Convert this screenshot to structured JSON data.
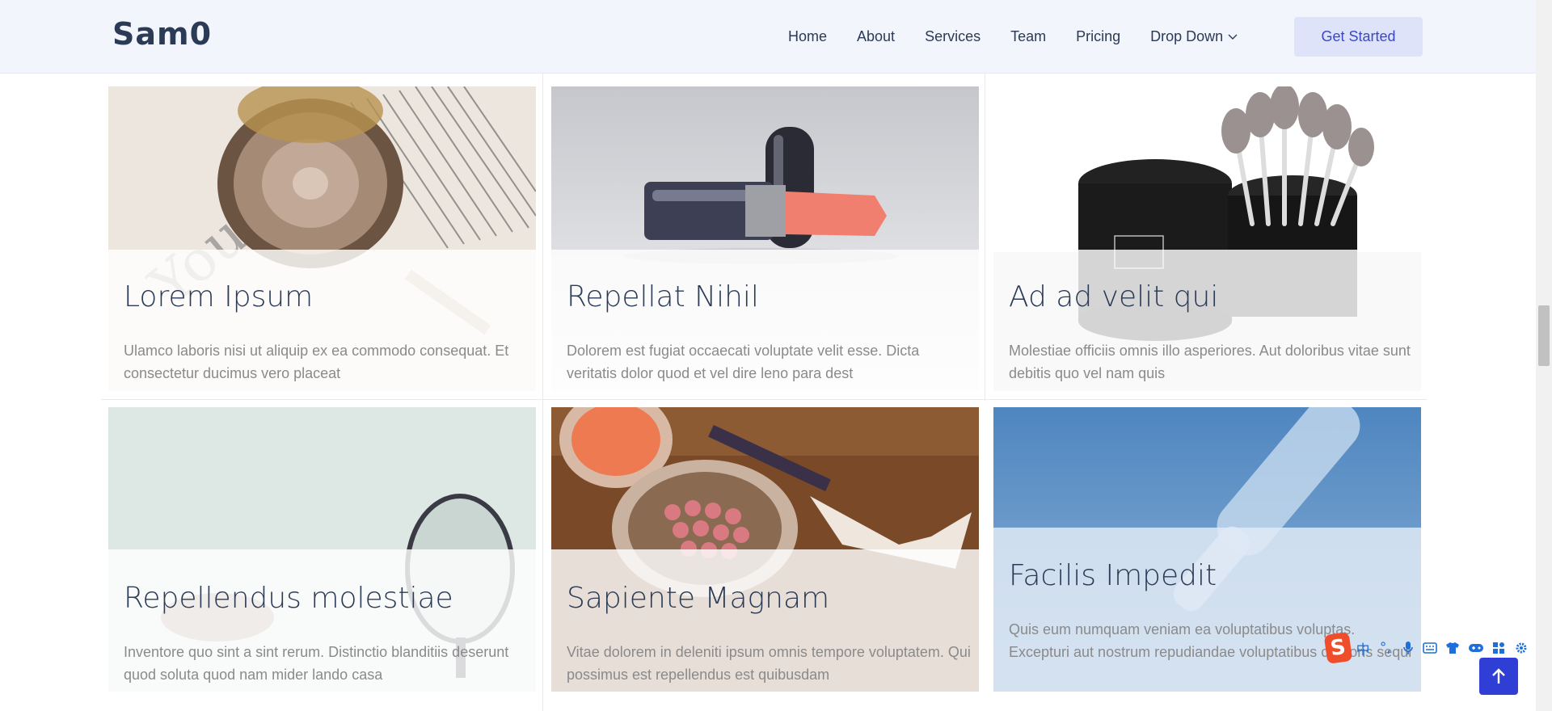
{
  "brand": {
    "logo": "Sam0"
  },
  "nav": {
    "items": [
      "Home",
      "About",
      "Services",
      "Team",
      "Pricing",
      "Drop Down"
    ],
    "cta": "Get Started"
  },
  "cards": [
    {
      "title": "Lorem Ipsum",
      "desc": "Ulamco laboris nisi ut aliquip ex ea commodo consequat. Et consectetur ducimus vero placeat"
    },
    {
      "title": "Repellat Nihil",
      "desc": "Dolorem est fugiat occaecati voluptate velit esse. Dicta veritatis dolor quod et vel dire leno para dest"
    },
    {
      "title": "Ad ad velit qui",
      "desc": "Molestiae officiis omnis illo asperiores. Aut doloribus vitae sunt debitis quo vel nam quis"
    },
    {
      "title": "Repellendus molestiae",
      "desc": "Inventore quo sint a sint rerum. Distinctio blanditiis deserunt quod soluta quod nam mider lando casa"
    },
    {
      "title": "Sapiente Magnam",
      "desc": "Vitae dolorem in deleniti ipsum omnis tempore voluptatem. Qui possimus est repellendus est quibusdam"
    },
    {
      "title": "Facilis Impedit",
      "desc": "Quis eum numquam veniam ea voluptatibus voluptas. Excepturi aut nostrum repudiandae voluptatibus corporis sequi"
    }
  ],
  "ime": {
    "glyph_s": "S",
    "glyph_zh": "中",
    "glyph_punct": "°,"
  },
  "colors": {
    "accent": "#2f3fd6",
    "cta_bg": "#dfe3fa",
    "header_bg": "#f3f5fd"
  }
}
